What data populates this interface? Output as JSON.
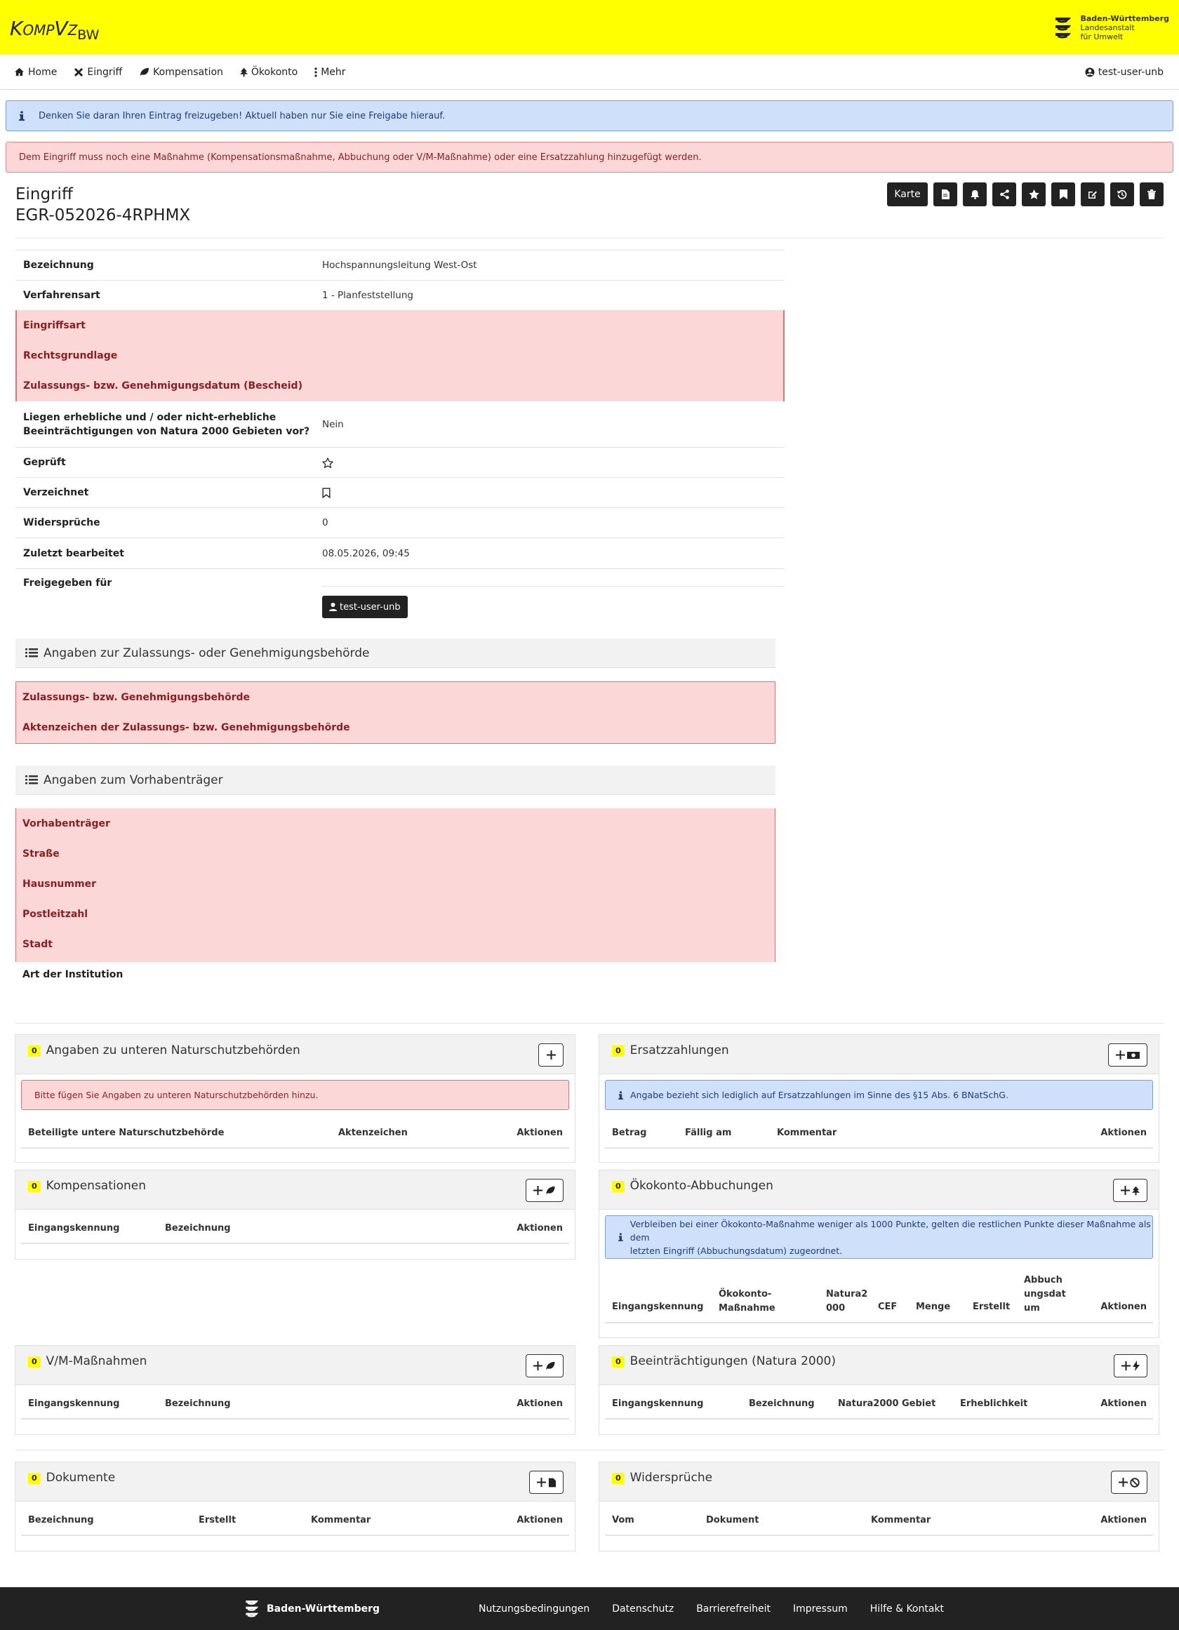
{
  "brand": {
    "name_main": "KompVz",
    "name_sub": "BW"
  },
  "lubw": {
    "line1": "Baden-Württemberg",
    "line2": "Landesanstalt",
    "line3": "für Umwelt"
  },
  "nav": {
    "items": [
      {
        "label": "Home",
        "icon": "home-icon"
      },
      {
        "label": "Eingriff",
        "icon": "tools-icon"
      },
      {
        "label": "Kompensation",
        "icon": "leaf-icon"
      },
      {
        "label": "Ökokonto",
        "icon": "tree-icon"
      },
      {
        "label": "Mehr",
        "icon": "ellipsis-vertical-icon"
      }
    ],
    "user": "test-user-unb"
  },
  "alerts": {
    "info": "Denken Sie daran Ihren Eintrag freizugeben! Aktuell haben nur Sie eine Freigabe hierauf.",
    "danger": "Dem Eingriff muss noch eine Maßnahme (Kompensationsmaßnahme, Abbuchung oder V/M-Maßnahme) oder eine Ersatzzahlung hinzugefügt werden."
  },
  "header": {
    "type": "Eingriff",
    "id": "EGR-052026-4RPHMX",
    "karte": "Karte"
  },
  "attributes": {
    "bezeichnung": {
      "label": "Bezeichnung",
      "value": "Hochspannungsleitung West-Ost"
    },
    "verfahrensart": {
      "label": "Verfahrensart",
      "value": "1 - Planfeststellung"
    },
    "eingriffsart": {
      "label": "Eingriffsart"
    },
    "rechtsgrundlage": {
      "label": "Rechtsgrundlage"
    },
    "zulassungsdatum": {
      "label": "Zulassungs- bzw. Genehmigungsdatum (Bescheid)"
    },
    "natura_l1": "Liegen erhebliche und / oder nicht-erhebliche",
    "natura_l2": "Beeinträchtigungen von Natura 2000 Gebieten vor?",
    "natura_value": "Nein",
    "geprueft": {
      "label": "Geprüft"
    },
    "verzeichnet": {
      "label": "Verzeichnet"
    },
    "widersprueche": {
      "label": "Widersprüche",
      "value": "0"
    },
    "zuletzt": {
      "label": "Zuletzt bearbeitet",
      "value": "08.05.2026, 09:45"
    },
    "freigegeben": {
      "label": "Freigegeben für",
      "user": "test-user-unb"
    }
  },
  "behoerde": {
    "title": "Angaben zur Zulassungs- oder Genehmigungsbehörde",
    "rows": [
      "Zulassungs- bzw. Genehmigungsbehörde",
      "Aktenzeichen der Zulassungs- bzw. Genehmigungsbehörde"
    ]
  },
  "vorhaben": {
    "title": "Angaben zum Vorhabenträger",
    "rows": [
      "Vorhabenträger",
      "Straße",
      "Hausnummer",
      "Postleitzahl",
      "Stadt"
    ],
    "art": "Art der Institution"
  },
  "cards": {
    "unb": {
      "count": "0",
      "title": "Angaben zu unteren Naturschutzbehörden",
      "alert": "Bitte fügen Sie Angaben zu unteren Naturschutzbehörden hinzu.",
      "cols": [
        "Beteiligte untere Naturschutzbehörde",
        "Aktenzeichen",
        "Aktionen"
      ]
    },
    "ersatz": {
      "count": "0",
      "title": "Ersatzzahlungen",
      "alert": "Angabe bezieht sich lediglich auf Ersatzzahlungen im Sinne des §15 Abs. 6 BNatSchG.",
      "cols": [
        "Betrag",
        "Fällig am",
        "Kommentar",
        "Aktionen"
      ]
    },
    "komp": {
      "count": "0",
      "title": "Kompensationen",
      "cols": [
        "Eingangskennung",
        "Bezeichnung",
        "Aktionen"
      ]
    },
    "oeko": {
      "count": "0",
      "title": "Ökokonto-Abbuchungen",
      "alert_l1": "Verbleiben bei einer Ökokonto-Maßnahme weniger als 1000 Punkte, gelten die restlichen Punkte dieser Maßnahme als dem",
      "alert_l2": "letzten Eingriff (Abbuchungsdatum) zugeordnet.",
      "c_eingang": "Eingangskennung",
      "c_massn_1": "Ökokonto-",
      "c_massn_2": "Maßnahme",
      "c_natura_1": "Natura2",
      "c_natura_2": "000",
      "c_cef": "CEF",
      "c_menge": "Menge",
      "c_erstellt": "Erstellt",
      "c_abb_1": "Abbuch",
      "c_abb_2": "ungsdat",
      "c_abb_3": "um",
      "c_aktionen": "Aktionen"
    },
    "vm": {
      "count": "0",
      "title": "V/M-Maßnahmen",
      "cols": [
        "Eingangskennung",
        "Bezeichnung",
        "Aktionen"
      ]
    },
    "natura": {
      "count": "0",
      "title": "Beeinträchtigungen (Natura 2000)",
      "cols": [
        "Eingangskennung",
        "Bezeichnung",
        "Natura2000 Gebiet",
        "Erheblichkeit",
        "Aktionen"
      ]
    },
    "dok": {
      "count": "0",
      "title": "Dokumente",
      "cols": [
        "Bezeichnung",
        "Erstellt",
        "Kommentar",
        "Aktionen"
      ]
    },
    "wider": {
      "count": "0",
      "title": "Widersprüche",
      "cols": [
        "Vom",
        "Dokument",
        "Kommentar",
        "Aktionen"
      ]
    }
  },
  "footer": {
    "brand": "Baden-Württemberg",
    "links": [
      "Nutzungsbedingungen",
      "Datenschutz",
      "Barrierefreiheit",
      "Impressum",
      "Hilfe & Kontakt"
    ]
  },
  "colors": {
    "accent": "#ffff00",
    "danger_bg": "#fcd7d8",
    "info_bg": "#cfe0fa",
    "dark": "#222222"
  }
}
